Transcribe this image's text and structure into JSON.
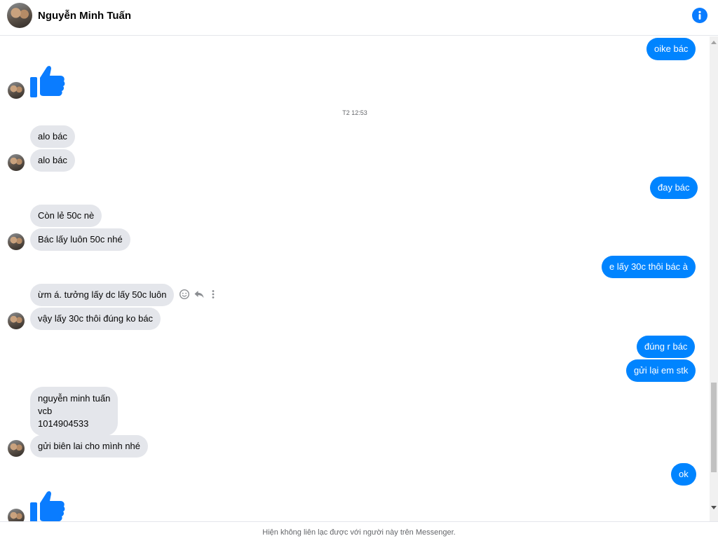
{
  "header": {
    "contact_name": "Nguyễn Minh Tuấn"
  },
  "thread": {
    "timestamp": "T2 12:53",
    "messages": {
      "m1": "oike bác",
      "m2": "alo bác",
      "m3": "alo bác",
      "m4": "đay bác",
      "m5": "Còn lẻ 50c nè",
      "m6": "Bác lấy luôn 50c nhé",
      "m7": "e lấy 30c thôi bác à",
      "m8": "ừm á. tưởng lấy dc lấy 50c luôn",
      "m9": "vậy lấy 30c thôi đúng ko bác",
      "m10": "đúng r bác",
      "m11": "gửi lại em stk",
      "m12_line1": "nguyễn minh tuấn",
      "m12_line2": "vcb",
      "m12_line3": "1014904533",
      "m13": "gửi biên lai cho mình nhé",
      "m14": "ok"
    }
  },
  "footer": {
    "notice": "Hiện không liên lạc được với người này trên Messenger."
  },
  "icons": {
    "info": "info-icon",
    "like": "thumbs-up-icon",
    "react": "smiley-icon",
    "reply": "reply-icon",
    "more": "more-vertical-icon"
  },
  "colors": {
    "accent": "#0084ff",
    "incoming_bubble": "#e4e6eb",
    "like_blue": "#0a7cff"
  }
}
